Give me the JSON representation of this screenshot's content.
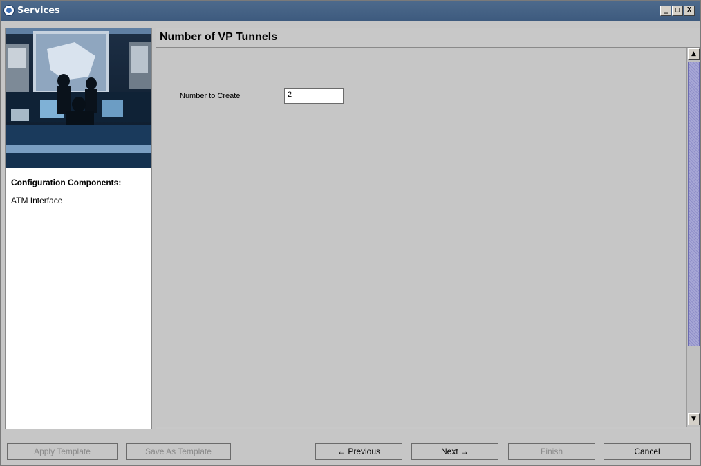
{
  "window": {
    "title": "Services",
    "controls": [
      "_",
      "□",
      "X"
    ]
  },
  "left_panel": {
    "components_title": "Configuration Components:",
    "items": [
      "ATM Interface"
    ]
  },
  "main": {
    "title": "Number of VP Tunnels",
    "field_label": "Number to Create",
    "field_value": "2"
  },
  "buttons": {
    "apply_template": "Apply Template",
    "save_as_template": "Save As Template",
    "previous": "← Previous",
    "next": "Next →",
    "finish": "Finish",
    "cancel": "Cancel"
  },
  "icons": {
    "scroll_up": "▲",
    "scroll_down": "▼"
  }
}
